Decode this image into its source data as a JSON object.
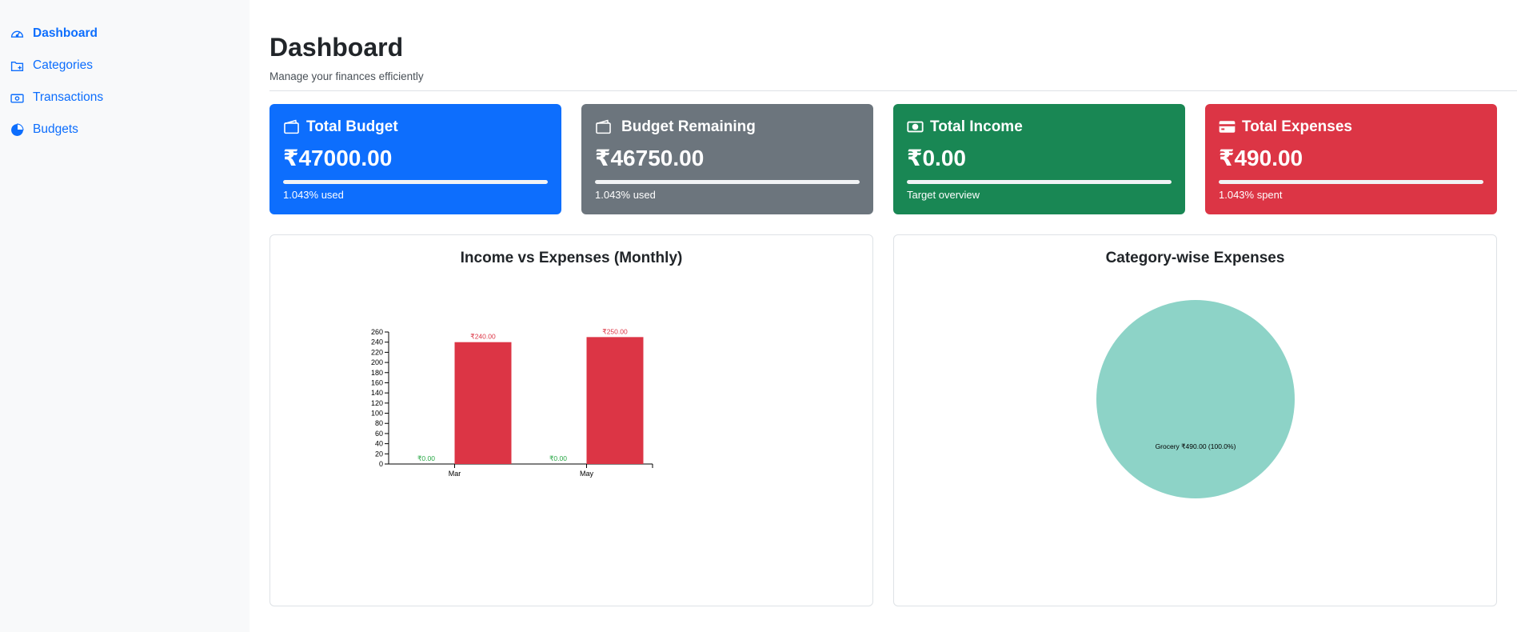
{
  "sidebar": {
    "items": [
      {
        "label": "Dashboard",
        "icon": "speedometer-icon",
        "active": true
      },
      {
        "label": "Categories",
        "icon": "folder-icon",
        "active": false
      },
      {
        "label": "Transactions",
        "icon": "cash-icon",
        "active": false
      },
      {
        "label": "Budgets",
        "icon": "pie-chart-icon",
        "active": false
      }
    ]
  },
  "header": {
    "title": "Dashboard",
    "subtitle": "Manage your finances efficiently"
  },
  "cards": [
    {
      "title": "Total Budget",
      "value": "₹47000.00",
      "note": "1.043% used",
      "progress": 1.0,
      "color": "#0d6efd",
      "icon": "wallet-icon"
    },
    {
      "title": "Budget Remaining",
      "value": "₹46750.00",
      "note": "1.043% used",
      "progress": 1.0,
      "color": "#6c757d",
      "icon": "wallet-icon"
    },
    {
      "title": "Total Income",
      "value": "₹0.00",
      "note": "Target overview",
      "progress": 1.0,
      "color": "#198754",
      "icon": "cash-icon"
    },
    {
      "title": "Total Expenses",
      "value": "₹490.00",
      "note": "1.043% spent",
      "progress": 1.0,
      "color": "#dc3545",
      "icon": "credit-card-icon"
    }
  ],
  "chart_data": [
    {
      "type": "bar",
      "title": "Income vs Expenses (Monthly)",
      "categories": [
        "Mar",
        "May"
      ],
      "series": [
        {
          "values": [
            0,
            0
          ],
          "labels": [
            "₹0.00",
            "₹0.00"
          ],
          "color": "#28a745"
        },
        {
          "values": [
            240,
            250
          ],
          "labels": [
            "₹240.00",
            "₹250.00"
          ],
          "color": "#dc3545"
        }
      ],
      "ylim": [
        0,
        260
      ],
      "yticks": [
        0,
        20,
        40,
        60,
        80,
        100,
        120,
        140,
        160,
        180,
        200,
        220,
        240,
        260
      ]
    },
    {
      "type": "pie",
      "title": "Category-wise Expenses",
      "slices": [
        {
          "label": "Grocery ₹490.00 (100.0%)",
          "value": 490,
          "color": "#8dd3c7"
        }
      ]
    }
  ]
}
